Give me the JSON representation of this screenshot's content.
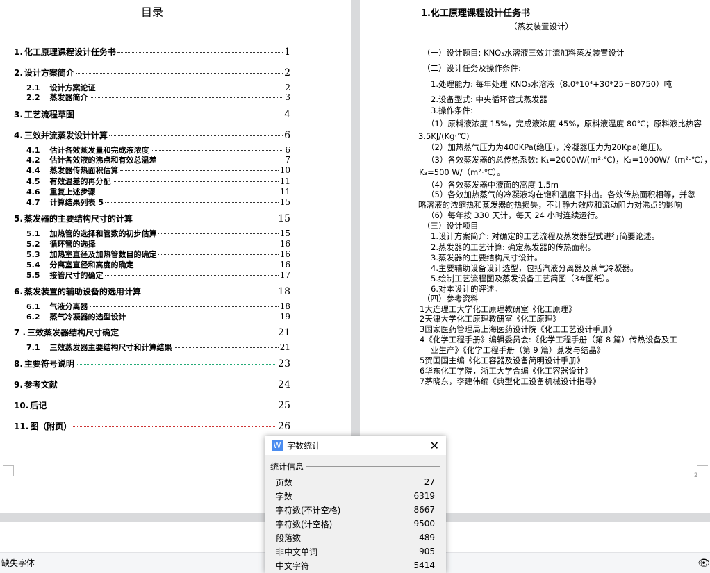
{
  "toc": {
    "title": "目录",
    "entries": [
      {
        "num": "1.",
        "label": "化工原理课程设计任务书",
        "page": "1",
        "level": 1
      },
      {
        "num": "2.",
        "label": "设计方案简介",
        "page": "2",
        "level": 1
      },
      {
        "num": "2.1",
        "label": "设计方案论证",
        "page": "2",
        "level": 2
      },
      {
        "num": "2.2",
        "label": "蒸发器简介",
        "page": "3",
        "level": 2
      },
      {
        "num": "3.",
        "label": "工艺流程草图",
        "page": "4",
        "level": 1
      },
      {
        "num": "4.",
        "label": "三效并流蒸发设计计算",
        "page": "6",
        "level": 1
      },
      {
        "num": "4.1",
        "label": "估计各效蒸发量和完成液浓度",
        "page": "6",
        "level": 2
      },
      {
        "num": "4.2",
        "label": "估计各效液的沸点和有效总温差",
        "page": "7",
        "level": 2
      },
      {
        "num": "4.4",
        "label": "蒸发器传热面积估算",
        "page": "10",
        "level": 2
      },
      {
        "num": "4.5",
        "label": "有效温差的再分配",
        "page": "11",
        "level": 2
      },
      {
        "num": "4.6",
        "label": "重复上述步骤",
        "page": "11",
        "level": 2
      },
      {
        "num": "4.7",
        "label": "计算结果列表 5",
        "page": "15",
        "level": 2
      },
      {
        "num": "5.",
        "label": "蒸发器的主要结构尺寸的计算",
        "page": "15",
        "level": 1
      },
      {
        "num": "5.1",
        "label": "加热管的选择和管数的初步估算",
        "page": "15",
        "level": 2
      },
      {
        "num": "5.2",
        "label": "循环管的选择",
        "page": "16",
        "level": 2
      },
      {
        "num": "5.3",
        "label": "加热室直径及加热管数目的确定",
        "page": "16",
        "level": 2
      },
      {
        "num": "5.4",
        "label": "分离室直径和高度的确定",
        "page": "16",
        "level": 2
      },
      {
        "num": "5.5",
        "label": "接管尺寸的确定",
        "page": "17",
        "level": 2
      },
      {
        "num": "6.",
        "label": "蒸发装置的辅助设备的选用计算",
        "page": "18",
        "level": 1
      },
      {
        "num": "6.1",
        "label": "气液分离器",
        "page": "18",
        "level": 2
      },
      {
        "num": "6.2",
        "label": "蒸气冷凝器的选型设计",
        "page": "19",
        "level": 2
      },
      {
        "num": "7 .",
        "label": "三效蒸发器结构尺寸确定",
        "page": "21",
        "level": 1
      },
      {
        "num": "7.1",
        "label": "三效蒸发器主要结构尺寸和计算结果",
        "page": "21",
        "level": 2
      },
      {
        "num": "8.",
        "label": "主要符号说明",
        "page": "23",
        "level": 1
      },
      {
        "num": "9.",
        "label": "参考文献",
        "page": "24",
        "level": 1
      },
      {
        "num": "10.",
        "label": "后记",
        "page": "25",
        "level": 1
      },
      {
        "num": "11.",
        "label": "图（附页）",
        "page": "26",
        "level": 1
      }
    ]
  },
  "right_page": {
    "lines": [
      "1.化工原理课程设计任务书",
      "（蒸发装置设计）",
      "（一）设计题目: KNO₃水溶液三效并流加料蒸发装置设计",
      "（二）设计任务及操作条件:",
      "1.处理能力: 每年处理 KNO₃水溶液（8.0*10⁴+30*25=80750）吨",
      "2.设备型式: 中央循环管式蒸发器",
      "3.操作条件:",
      "（1）原料液浓度 15%，完成液浓度 45%，原料液温度 80℃；原料液比热容",
      "3.5KJ/(Kg·℃)",
      "（2）加热蒸气压力为400KPa(绝压)，冷凝器压力为20Kpa(绝压)。",
      "（3）各效蒸发器的总传热系数: K₁=2000W/(m²·℃)，K₂=1000W/（m²·℃），",
      "K₃=500 W/（m²·℃）。",
      "（4）各效蒸发器中液面的高度 1.5m",
      "（5）各效加热蒸气的冷凝液均在饱和温度下排出。各效传热面积相等，并忽",
      "略溶液的浓缩热和蒸发器的热损失，不计静力效应和流动阻力对沸点的影响",
      "（6）每年按 330 天计，每天 24 小时连续运行。",
      "（三）设计项目",
      "1.设计方案简介: 对确定的工艺流程及蒸发器型式进行简要论述。",
      "2.蒸发器的工艺计算: 确定蒸发器的传热面积。",
      "3.蒸发器的主要结构尺寸设计。",
      "4.主要辅助设备设计选型，包括汽液分离器及蒸气冷凝器。",
      "5.绘制工艺流程图及蒸发设备工艺简图（3#图纸）。",
      "6.对本设计的评述。",
      "（四）参考资料",
      "1大连理工大学化工原理教研室《化工原理》",
      "2天津大学化工原理教研室《化工原理》",
      "3国家医药管理局上海医药设计院《化工工艺设计手册》",
      "4《化学工程手册》编辑委员会:《化学工程手册（第 8 篇）传热设备及工",
      "业生产》《化学工程手册（第 9 篇）蒸发与结晶》",
      "5贺国国主编《化工容器及设备简明设计手册》",
      "6华东化工学院，浙工大学合编《化工容器设计》",
      "7茅晓东，李建伟编《典型化工设备机械设计指导》"
    ],
    "page_number": "2"
  },
  "dialog": {
    "title": "字数统计",
    "icon": "W",
    "group": "统计信息",
    "rows": [
      {
        "label": "页数",
        "value": "27"
      },
      {
        "label": "字数",
        "value": "6319"
      },
      {
        "label": "字符数(不计空格)",
        "value": "8667"
      },
      {
        "label": "字符数(计空格)",
        "value": "9500"
      },
      {
        "label": "段落数",
        "value": "489"
      },
      {
        "label": "非中文单词",
        "value": "905"
      },
      {
        "label": "中文字符",
        "value": "5414"
      }
    ]
  },
  "status": {
    "missing_fonts": "缺失字体"
  }
}
